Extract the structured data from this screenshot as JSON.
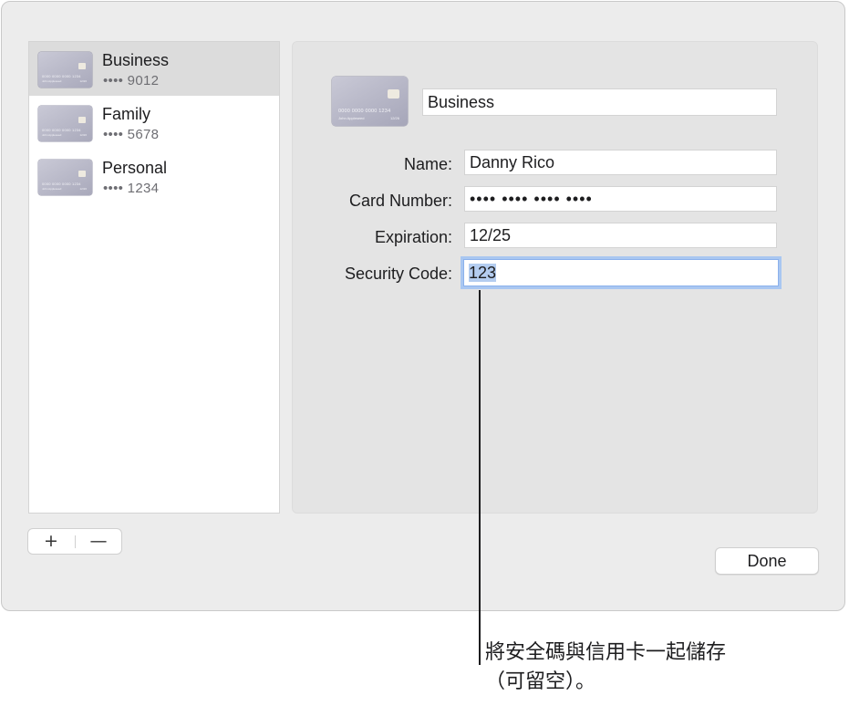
{
  "card_list": {
    "items": [
      {
        "name": "Business",
        "masked": "•••• 9012",
        "selected": true
      },
      {
        "name": "Family",
        "masked": "•••• 5678",
        "selected": false
      },
      {
        "name": "Personal",
        "masked": "•••• 1234",
        "selected": false
      }
    ],
    "add_label": "+",
    "remove_label": "—"
  },
  "card_art": {
    "number": "0000 0000 0000 1234",
    "holder": "John Appleseed",
    "expiry": "12/26",
    "colors": {
      "body_start": "#c9c9d6",
      "body_end": "#a9a9bb",
      "chip": "#eeeae0"
    }
  },
  "detail": {
    "description": "Business",
    "fields": [
      {
        "label": "Name:",
        "value": "Danny Rico"
      },
      {
        "label": "Card Number:",
        "value": "•••• •••• •••• ••••"
      },
      {
        "label": "Expiration:",
        "value": "12/25"
      },
      {
        "label": "Security Code:",
        "value": "123"
      }
    ],
    "focused_field": "Security Code:"
  },
  "done_label": "Done",
  "callout": {
    "text": "將安全碼與信用卡一起儲存（可留空）。"
  },
  "colors": {
    "sheet_bg": "#ececec",
    "selected_row": "#dcdcdc",
    "focus_ring": "#a9c7f1",
    "text_selection": "#b4cdf0"
  }
}
